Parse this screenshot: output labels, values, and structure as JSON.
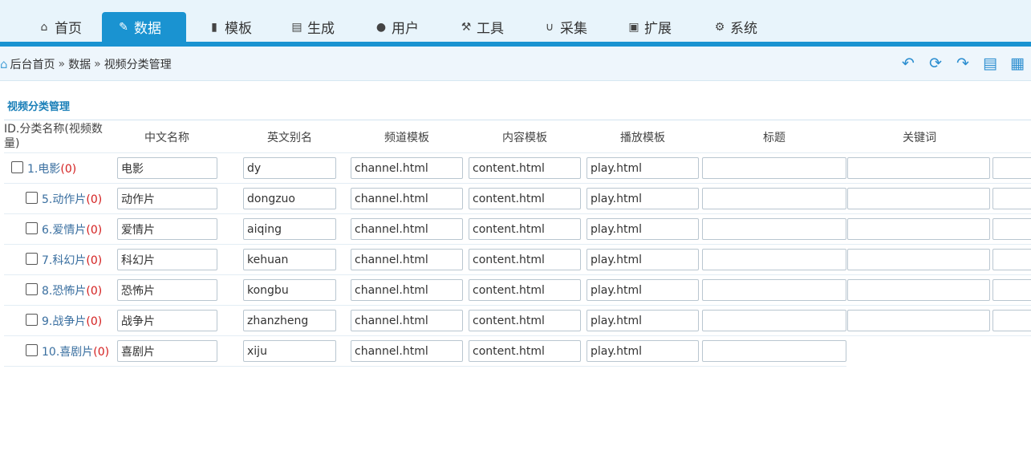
{
  "nav": [
    {
      "label": "首页",
      "icon": "home-icon"
    },
    {
      "label": "数据",
      "icon": "edit-icon"
    },
    {
      "label": "模板",
      "icon": "file-icon"
    },
    {
      "label": "生成",
      "icon": "server-icon"
    },
    {
      "label": "用户",
      "icon": "user-icon"
    },
    {
      "label": "工具",
      "icon": "wrench-icon"
    },
    {
      "label": "采集",
      "icon": "magnet-icon"
    },
    {
      "label": "扩展",
      "icon": "puzzle-icon"
    },
    {
      "label": "系统",
      "icon": "gear-icon"
    }
  ],
  "breadcrumb": {
    "home": "后台首页",
    "sep": "»",
    "level1": "数据",
    "level2": "视频分类管理"
  },
  "page_title": "视频分类管理",
  "table": {
    "headers": {
      "id_name": "ID.分类名称(视频数量)",
      "cn_name": "中文名称",
      "en_alias": "英文别名",
      "channel_tpl": "频道模板",
      "content_tpl": "内容模板",
      "play_tpl": "播放模板",
      "title": "标题",
      "keywords": "关键词"
    },
    "rows": [
      {
        "id_label": "1.电影",
        "count": "(0)",
        "cn": "电影",
        "en": "dy",
        "channel": "channel.html",
        "content": "content.html",
        "play": "play.html",
        "title": "",
        "keywords": "",
        "extra": ""
      },
      {
        "id_label": "5.动作片",
        "count": "(0)",
        "cn": "动作片",
        "en": "dongzuo",
        "channel": "channel.html",
        "content": "content.html",
        "play": "play.html",
        "title": "",
        "keywords": "",
        "extra": ""
      },
      {
        "id_label": "6.爱情片",
        "count": "(0)",
        "cn": "爱情片",
        "en": "aiqing",
        "channel": "channel.html",
        "content": "content.html",
        "play": "play.html",
        "title": "",
        "keywords": "",
        "extra": ""
      },
      {
        "id_label": "7.科幻片",
        "count": "(0)",
        "cn": "科幻片",
        "en": "kehuan",
        "channel": "channel.html",
        "content": "content.html",
        "play": "play.html",
        "title": "",
        "keywords": "",
        "extra": ""
      },
      {
        "id_label": "8.恐怖片",
        "count": "(0)",
        "cn": "恐怖片",
        "en": "kongbu",
        "channel": "channel.html",
        "content": "content.html",
        "play": "play.html",
        "title": "",
        "keywords": "",
        "extra": ""
      },
      {
        "id_label": "9.战争片",
        "count": "(0)",
        "cn": "战争片",
        "en": "zhanzheng",
        "channel": "channel.html",
        "content": "content.html",
        "play": "play.html",
        "title": "",
        "keywords": "",
        "extra": ""
      },
      {
        "id_label": "10.喜剧片",
        "count": "(0)",
        "cn": "喜剧片",
        "en": "xiju",
        "channel": "channel.html",
        "content": "content.html",
        "play": "play.html",
        "title": ""
      }
    ]
  },
  "colors": {
    "accent": "#1a93d1",
    "count": "#d42020",
    "link": "#3a6fa0"
  }
}
